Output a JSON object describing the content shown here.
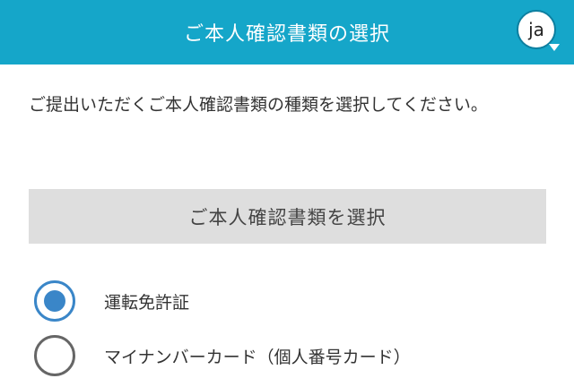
{
  "header": {
    "title": "ご本人確認書類の選択",
    "language_code": "ja",
    "accent_color": "#15a6c9"
  },
  "instruction": "ご提出いただくご本人確認書類の種類を選択してください。",
  "select_button": {
    "label": "ご本人確認書類を選択"
  },
  "options": [
    {
      "label": "運転免許証",
      "selected": true
    },
    {
      "label": "マイナンバーカード（個人番号カード）",
      "selected": false
    }
  ]
}
